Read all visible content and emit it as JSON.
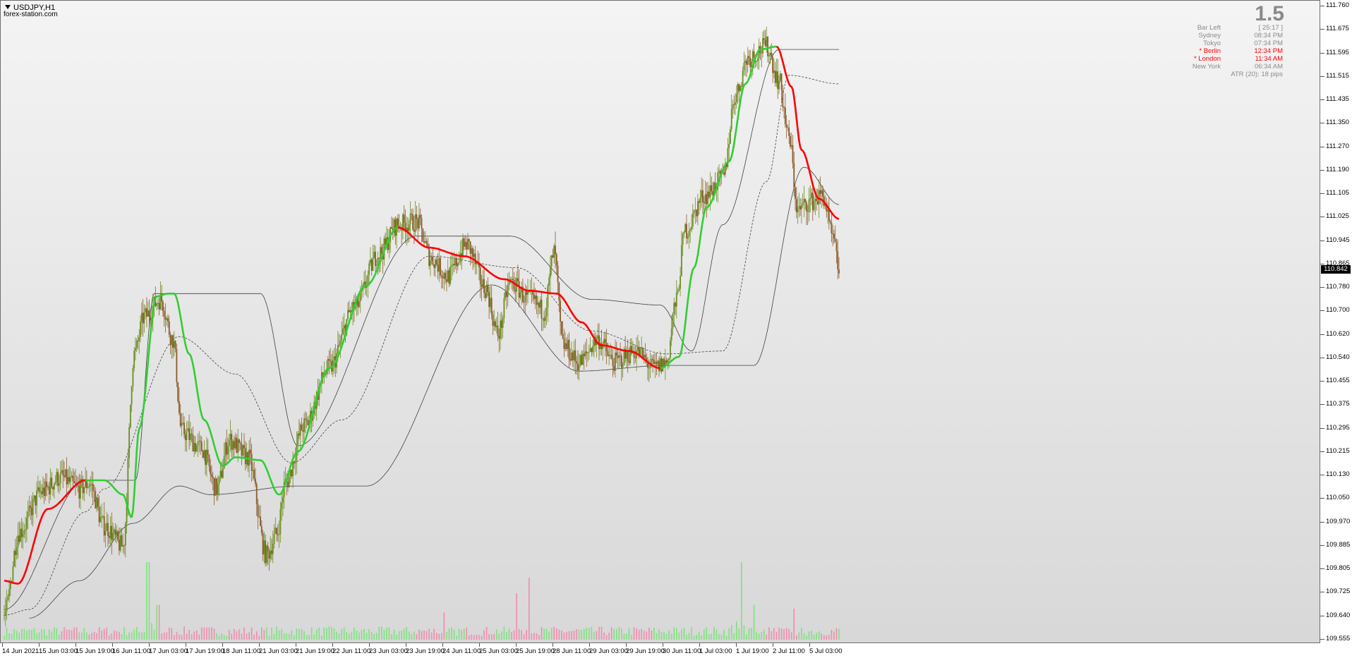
{
  "header": {
    "symbol": "USDJPY,H1",
    "website": "forex-station.com",
    "big_value": "1.5"
  },
  "info_panel": [
    {
      "key": "Bar Left",
      "value": "[ 25:17 ]",
      "highlight": false
    },
    {
      "key": "Sydney",
      "value": "08:34 PM",
      "highlight": false
    },
    {
      "key": "Tokyo",
      "value": "07:34 PM",
      "highlight": false
    },
    {
      "key": "* Berlin",
      "value": "12:34 PM",
      "highlight": true
    },
    {
      "key": "* London",
      "value": "11:34 AM",
      "highlight": true
    },
    {
      "key": "New York",
      "value": "06:34 AM",
      "highlight": false
    },
    {
      "key": "ATR (20): 18 pips",
      "value": "",
      "highlight": false
    }
  ],
  "price_axis": {
    "labels": [
      "111.760",
      "111.675",
      "111.595",
      "111.515",
      "111.435",
      "111.350",
      "111.270",
      "111.190",
      "111.105",
      "111.025",
      "110.945",
      "110.865",
      "110.780",
      "110.700",
      "110.620",
      "110.540",
      "110.455",
      "110.375",
      "110.295",
      "110.215",
      "110.130",
      "110.050",
      "109.970",
      "109.885",
      "109.805",
      "109.725",
      "109.640",
      "109.555"
    ],
    "current_price": "110.842"
  },
  "time_axis": {
    "labels": [
      "14 Jun 2021",
      "15 Jun 03:00",
      "15 Jun 19:00",
      "16 Jun 11:00",
      "17 Jun 03:00",
      "17 Jun 19:00",
      "18 Jun 11:00",
      "21 Jun 03:00",
      "21 Jun 19:00",
      "22 Jun 11:00",
      "23 Jun 03:00",
      "23 Jun 19:00",
      "24 Jun 11:00",
      "25 Jun 03:00",
      "25 Jun 19:00",
      "28 Jun 11:00",
      "29 Jun 03:00",
      "29 Jun 19:00",
      "30 Jun 11:00",
      "1 Jul 03:00",
      "1 Jul 19:00",
      "2 Jul 11:00",
      "5 Jul 03:00"
    ]
  },
  "colors": {
    "bull_candle": "#6b8e23",
    "bear_candle": "#8b5a2b",
    "trend_up": "#32cd32",
    "trend_down": "#ff0000",
    "band": "#404040",
    "volume_up": "#7fe27f",
    "volume_down": "#f08cad",
    "label_red": "#ff0000",
    "label_gray": "#8a8a8a"
  },
  "chart_data": {
    "type": "candlestick",
    "symbol": "USDJPY",
    "timeframe": "H1",
    "ylim": [
      109.555,
      111.76
    ],
    "trend_line_points": [
      {
        "t": 0,
        "p": 109.76
      },
      {
        "t": 11,
        "p": 109.75
      },
      {
        "t": 35,
        "p": 110.01
      },
      {
        "t": 65,
        "p": 110.11
      },
      {
        "t": 80,
        "p": 110.11
      },
      {
        "t": 95,
        "p": 110.06
      },
      {
        "t": 102,
        "p": 109.98
      },
      {
        "t": 108,
        "p": 110.29
      },
      {
        "t": 122,
        "p": 110.75
      },
      {
        "t": 131,
        "p": 110.76
      },
      {
        "t": 136,
        "p": 110.76
      },
      {
        "t": 148,
        "p": 110.55
      },
      {
        "t": 160,
        "p": 110.32
      },
      {
        "t": 175,
        "p": 110.16
      },
      {
        "t": 185,
        "p": 110.19
      },
      {
        "t": 205,
        "p": 110.18
      },
      {
        "t": 220,
        "p": 110.06
      },
      {
        "t": 235,
        "p": 110.21
      },
      {
        "t": 260,
        "p": 110.5
      },
      {
        "t": 290,
        "p": 110.79
      },
      {
        "t": 315,
        "p": 110.99
      },
      {
        "t": 340,
        "p": 110.92
      },
      {
        "t": 368,
        "p": 110.89
      },
      {
        "t": 400,
        "p": 110.81
      },
      {
        "t": 420,
        "p": 110.77
      },
      {
        "t": 442,
        "p": 110.76
      },
      {
        "t": 462,
        "p": 110.66
      },
      {
        "t": 478,
        "p": 110.58
      },
      {
        "t": 500,
        "p": 110.56
      },
      {
        "t": 525,
        "p": 110.5
      },
      {
        "t": 540,
        "p": 110.54
      },
      {
        "t": 552,
        "p": 110.85
      },
      {
        "t": 562,
        "p": 111.06
      },
      {
        "t": 580,
        "p": 111.22
      },
      {
        "t": 593,
        "p": 111.49
      },
      {
        "t": 605,
        "p": 111.61
      },
      {
        "t": 618,
        "p": 111.62
      },
      {
        "t": 630,
        "p": 111.48
      },
      {
        "t": 638,
        "p": 111.26
      },
      {
        "t": 652,
        "p": 111.09
      },
      {
        "t": 668,
        "p": 111.02
      }
    ],
    "trend_turns": [
      0,
      65,
      102,
      131,
      175,
      220,
      315,
      525,
      618
    ],
    "band_upper_points": [
      {
        "t": 0,
        "p": 109.66
      },
      {
        "t": 65,
        "p": 110.11
      },
      {
        "t": 105,
        "p": 110.11
      },
      {
        "t": 120,
        "p": 110.76
      },
      {
        "t": 205,
        "p": 110.76
      },
      {
        "t": 235,
        "p": 110.23
      },
      {
        "t": 330,
        "p": 110.96
      },
      {
        "t": 405,
        "p": 110.96
      },
      {
        "t": 470,
        "p": 110.74
      },
      {
        "t": 525,
        "p": 110.72
      },
      {
        "t": 550,
        "p": 110.56
      },
      {
        "t": 575,
        "p": 111.0
      },
      {
        "t": 620,
        "p": 111.61
      },
      {
        "t": 668,
        "p": 111.61
      }
    ],
    "band_lower_points": [
      {
        "t": 20,
        "p": 109.63
      },
      {
        "t": 60,
        "p": 109.76
      },
      {
        "t": 103,
        "p": 109.96
      },
      {
        "t": 140,
        "p": 110.09
      },
      {
        "t": 165,
        "p": 110.06
      },
      {
        "t": 235,
        "p": 110.09
      },
      {
        "t": 290,
        "p": 110.09
      },
      {
        "t": 390,
        "p": 110.79
      },
      {
        "t": 460,
        "p": 110.49
      },
      {
        "t": 530,
        "p": 110.51
      },
      {
        "t": 600,
        "p": 110.51
      },
      {
        "t": 640,
        "p": 111.2
      },
      {
        "t": 668,
        "p": 111.07
      }
    ],
    "band_mid_points": [
      {
        "t": 0,
        "p": 109.64
      },
      {
        "t": 20,
        "p": 109.66
      },
      {
        "t": 65,
        "p": 110.0
      },
      {
        "t": 80,
        "p": 110.08
      },
      {
        "t": 140,
        "p": 110.61
      },
      {
        "t": 185,
        "p": 110.48
      },
      {
        "t": 230,
        "p": 110.17
      },
      {
        "t": 270,
        "p": 110.32
      },
      {
        "t": 340,
        "p": 110.89
      },
      {
        "t": 410,
        "p": 110.85
      },
      {
        "t": 470,
        "p": 110.63
      },
      {
        "t": 530,
        "p": 110.55
      },
      {
        "t": 575,
        "p": 110.56
      },
      {
        "t": 610,
        "p": 111.15
      },
      {
        "t": 628,
        "p": 111.52
      },
      {
        "t": 668,
        "p": 111.49
      }
    ],
    "price_path": [
      {
        "t": 0,
        "p": 109.64
      },
      {
        "t": 12,
        "p": 109.93
      },
      {
        "t": 30,
        "p": 110.07
      },
      {
        "t": 45,
        "p": 110.12
      },
      {
        "t": 60,
        "p": 110.08
      },
      {
        "t": 68,
        "p": 110.1
      },
      {
        "t": 80,
        "p": 109.95
      },
      {
        "t": 95,
        "p": 109.88
      },
      {
        "t": 104,
        "p": 110.55
      },
      {
        "t": 112,
        "p": 110.68
      },
      {
        "t": 125,
        "p": 110.74
      },
      {
        "t": 135,
        "p": 110.6
      },
      {
        "t": 142,
        "p": 110.28
      },
      {
        "t": 158,
        "p": 110.22
      },
      {
        "t": 170,
        "p": 110.08
      },
      {
        "t": 180,
        "p": 110.25
      },
      {
        "t": 195,
        "p": 110.19
      },
      {
        "t": 210,
        "p": 109.85
      },
      {
        "t": 218,
        "p": 109.92
      },
      {
        "t": 225,
        "p": 110.1
      },
      {
        "t": 240,
        "p": 110.3
      },
      {
        "t": 260,
        "p": 110.5
      },
      {
        "t": 280,
        "p": 110.71
      },
      {
        "t": 300,
        "p": 110.9
      },
      {
        "t": 315,
        "p": 111.0
      },
      {
        "t": 330,
        "p": 111.01
      },
      {
        "t": 342,
        "p": 110.88
      },
      {
        "t": 355,
        "p": 110.82
      },
      {
        "t": 370,
        "p": 110.93
      },
      {
        "t": 385,
        "p": 110.78
      },
      {
        "t": 395,
        "p": 110.62
      },
      {
        "t": 405,
        "p": 110.8
      },
      {
        "t": 420,
        "p": 110.74
      },
      {
        "t": 432,
        "p": 110.7
      },
      {
        "t": 440,
        "p": 110.9
      },
      {
        "t": 447,
        "p": 110.58
      },
      {
        "t": 460,
        "p": 110.52
      },
      {
        "t": 475,
        "p": 110.6
      },
      {
        "t": 488,
        "p": 110.52
      },
      {
        "t": 505,
        "p": 110.56
      },
      {
        "t": 520,
        "p": 110.5
      },
      {
        "t": 530,
        "p": 110.52
      },
      {
        "t": 537,
        "p": 110.72
      },
      {
        "t": 545,
        "p": 110.98
      },
      {
        "t": 560,
        "p": 111.1
      },
      {
        "t": 575,
        "p": 111.16
      },
      {
        "t": 585,
        "p": 111.45
      },
      {
        "t": 595,
        "p": 111.58
      },
      {
        "t": 610,
        "p": 111.62
      },
      {
        "t": 620,
        "p": 111.5
      },
      {
        "t": 628,
        "p": 111.3
      },
      {
        "t": 635,
        "p": 111.05
      },
      {
        "t": 645,
        "p": 111.08
      },
      {
        "t": 655,
        "p": 111.1
      },
      {
        "t": 663,
        "p": 110.95
      },
      {
        "t": 668,
        "p": 110.84
      }
    ],
    "volume_spikes": [
      {
        "t": 115,
        "v": 1.0
      },
      {
        "t": 123,
        "v": 0.45
      },
      {
        "t": 352,
        "v": 0.35
      },
      {
        "t": 410,
        "v": 0.6
      },
      {
        "t": 420,
        "v": 0.8
      },
      {
        "t": 590,
        "v": 1.0
      },
      {
        "t": 600,
        "v": 0.45
      },
      {
        "t": 632,
        "v": 0.4
      }
    ],
    "total_bars": 669
  }
}
